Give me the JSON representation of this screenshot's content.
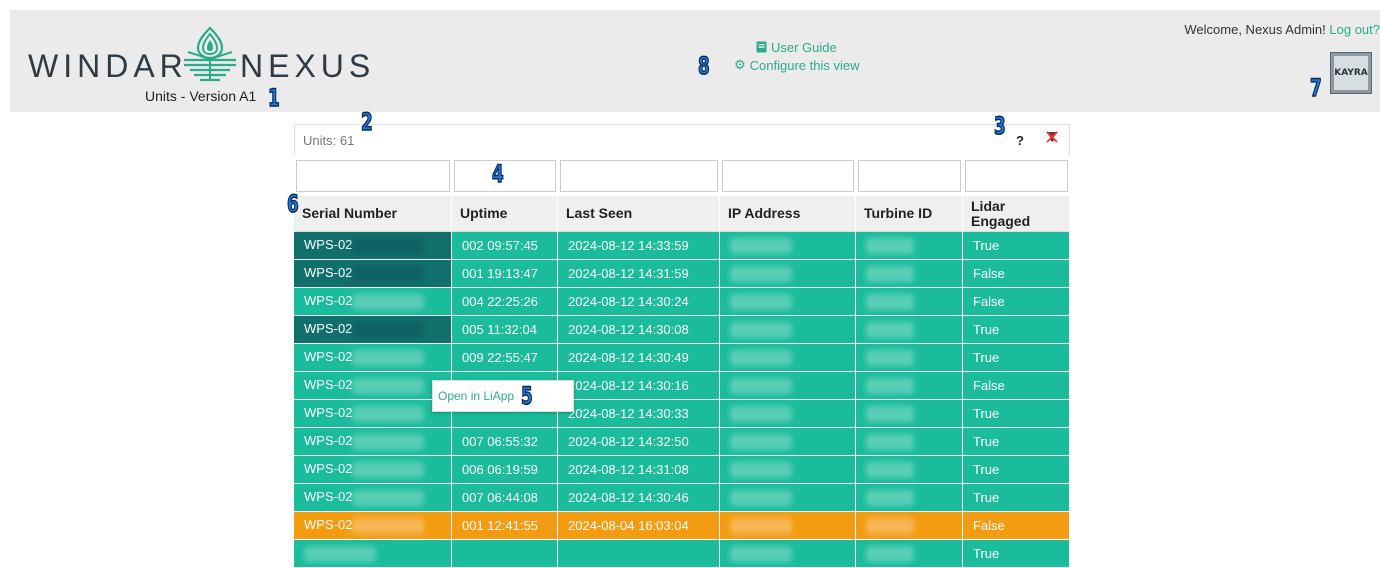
{
  "header": {
    "logo_left": "WINDAR",
    "logo_right": "NEXUS",
    "subtitle": "Units - Version A1",
    "user_guide_label": "User Guide",
    "configure_label": "Configure this view",
    "welcome_text": "Welcome, Nexus Admin!",
    "logout_label": "Log out?",
    "partner_logo": "KAYRA"
  },
  "markers": [
    "1",
    "2",
    "3",
    "4",
    "5",
    "6",
    "7",
    "8"
  ],
  "toolbar": {
    "units_count": "Units: 61",
    "help_label": "?",
    "clear_filter_icon": "filter-clear-icon"
  },
  "table": {
    "columns": [
      "Serial Number",
      "Uptime",
      "Last Seen",
      "IP Address",
      "Turbine ID",
      "Lidar Engaged"
    ],
    "rows": [
      {
        "serial": "WPS-02",
        "uptime": "002 09:57:45",
        "last_seen": "2024-08-12 14:33:59",
        "lidar": "True",
        "status": "ok",
        "serial_dark": true
      },
      {
        "serial": "WPS-02",
        "uptime": "001 19:13:47",
        "last_seen": "2024-08-12 14:31:59",
        "lidar": "False",
        "status": "ok",
        "serial_dark": true
      },
      {
        "serial": "WPS-02",
        "uptime": "004 22:25:26",
        "last_seen": "2024-08-12 14:30:24",
        "lidar": "False",
        "status": "ok",
        "serial_dark": false
      },
      {
        "serial": "WPS-02",
        "uptime": "005 11:32:04",
        "last_seen": "2024-08-12 14:30:08",
        "lidar": "True",
        "status": "ok",
        "serial_dark": true
      },
      {
        "serial": "WPS-02",
        "uptime": "009 22:55:47",
        "last_seen": "2024-08-12 14:30:49",
        "lidar": "True",
        "status": "ok",
        "serial_dark": false
      },
      {
        "serial": "WPS-02",
        "uptime": "",
        "last_seen": "2024-08-12 14:30:16",
        "lidar": "False",
        "status": "ok",
        "serial_dark": false
      },
      {
        "serial": "WPS-02",
        "uptime": "",
        "last_seen": "2024-08-12 14:30:33",
        "lidar": "True",
        "status": "ok",
        "serial_dark": false
      },
      {
        "serial": "WPS-02",
        "uptime": "007 06:55:32",
        "last_seen": "2024-08-12 14:32:50",
        "lidar": "True",
        "status": "ok",
        "serial_dark": false
      },
      {
        "serial": "WPS-02",
        "uptime": "006 06:19:59",
        "last_seen": "2024-08-12 14:31:08",
        "lidar": "True",
        "status": "ok",
        "serial_dark": false
      },
      {
        "serial": "WPS-02",
        "uptime": "007 06:44:08",
        "last_seen": "2024-08-12 14:30:46",
        "lidar": "True",
        "status": "ok",
        "serial_dark": false
      },
      {
        "serial": "WPS-02",
        "uptime": "001 12:41:55",
        "last_seen": "2024-08-04 16:03:04",
        "lidar": "False",
        "status": "warn",
        "serial_dark": false
      },
      {
        "serial": "",
        "uptime": "",
        "last_seen": "",
        "lidar": "True",
        "status": "ok",
        "serial_dark": false
      }
    ]
  },
  "context_menu": {
    "open_label": "Open in LiApp"
  },
  "colors": {
    "row_ok": "#1abc9c",
    "row_warn": "#f39c12",
    "serial_dark": "#11706b",
    "link": "#2bab8b",
    "marker": "#1e7bd8"
  }
}
